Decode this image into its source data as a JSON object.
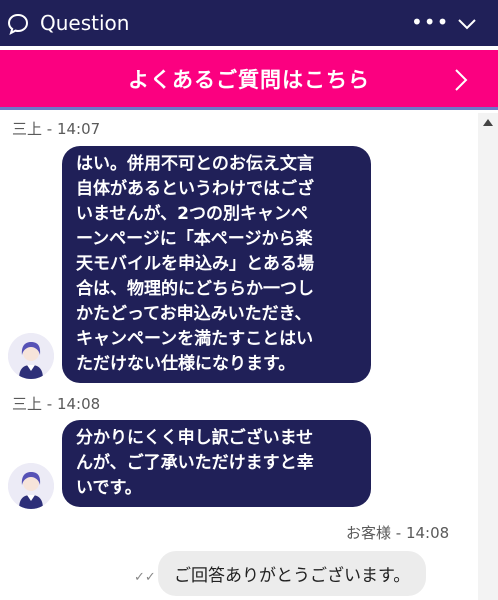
{
  "header": {
    "title": "Question",
    "more_label": "•••"
  },
  "faq": {
    "label": "よくあるご質問はこちら"
  },
  "messages": [
    {
      "sender": "三上 - 14:07",
      "lines": [
        "はい。併用不可とのお伝え文言",
        "自体があるというわけではござ",
        "いませんが、2つの別キャンペ",
        "ーンページに「本ページから楽",
        "天モバイルを申込み」とある場",
        "合は、物理的にどちらか一つし",
        "かたどってお申込みいただき、",
        "キャンペーンを満たすことはい",
        "ただけない仕様になります。"
      ]
    },
    {
      "sender": "三上 - 14:08",
      "lines": [
        "分かりにくく申し訳ございませ",
        "んが、ご了承いただけますと幸",
        "いです。"
      ]
    }
  ],
  "user_message": {
    "sender": "お客様 - 14:08",
    "text": "ご回答ありがとうございます。",
    "status": "✓✓"
  },
  "colors": {
    "header_bg": "#202058",
    "faq_bg": "#fb0080",
    "agent_bubble": "#202058",
    "user_bubble": "#ececec"
  }
}
